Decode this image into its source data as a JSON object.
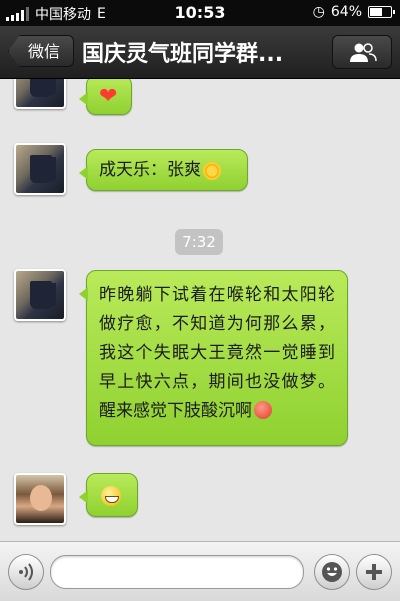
{
  "status_bar": {
    "carrier": "中国移动",
    "network": "E",
    "time": "10:53",
    "battery_text": "64%",
    "battery_level": 0.64
  },
  "nav": {
    "back_label": "微信",
    "title": "国庆灵气班同学群..."
  },
  "chat": {
    "timestamp": "7:32",
    "messages": [
      {
        "sender_icon": "mug-avatar",
        "content": "heart-emoji"
      },
      {
        "sender_icon": "mug-avatar",
        "text": "成天乐：张爽"
      },
      {
        "sender_icon": "mug-avatar",
        "text": "昨晚躺下试着在喉轮和太阳轮做疗愈，不知道为何那么累，我这个失眠大王竟然一觉睡到早上快六点，期间也没做梦。醒来感觉下肢酸沉啊"
      },
      {
        "sender_icon": "person-avatar",
        "content": "grin-emoji"
      }
    ]
  },
  "colors": {
    "bubble": "#a6df45",
    "navbar": "#2b2b2b",
    "background": "#e6e6e6"
  },
  "icons": {
    "members": "people-icon",
    "voice": "voice-icon",
    "emoji": "smiley-icon",
    "add": "plus-icon"
  }
}
